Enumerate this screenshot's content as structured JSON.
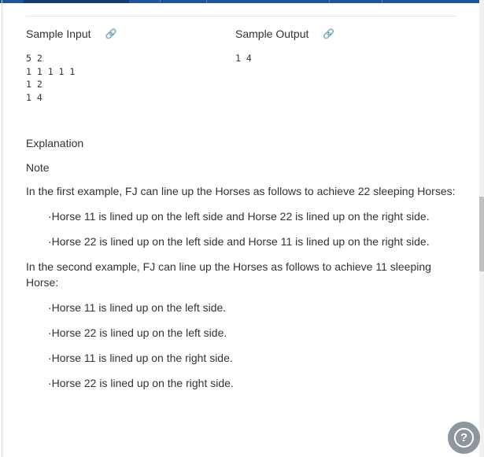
{
  "sample_input": {
    "title": "Sample Input",
    "text": "5 2\n1 1 1 1 1\n1 2\n1 4"
  },
  "sample_output": {
    "title": "Sample Output",
    "text": "1 4"
  },
  "explanation": "Explanation",
  "note": "Note",
  "paragraphs": [
    "In the first example, FJ can line up the Horses as follows to achieve 22 sleeping Horses:",
    "·Horse 11 is lined up on the left side and Horse 22 is lined up on the right side.",
    "·Horse 22 is lined up on the left side and Horse 11 is lined up on the right side.",
    "In the second example, FJ can line up the Horses as follows to achieve 11 sleeping Horse:",
    "·Horse 11 is lined up on the left side.",
    "·Horse 22 is lined up on the left side.",
    "·Horse 11 is lined up on the right side.",
    "·Horse 22 is lined up on the right side."
  ],
  "help_label": "?",
  "link_icon": "🔗"
}
